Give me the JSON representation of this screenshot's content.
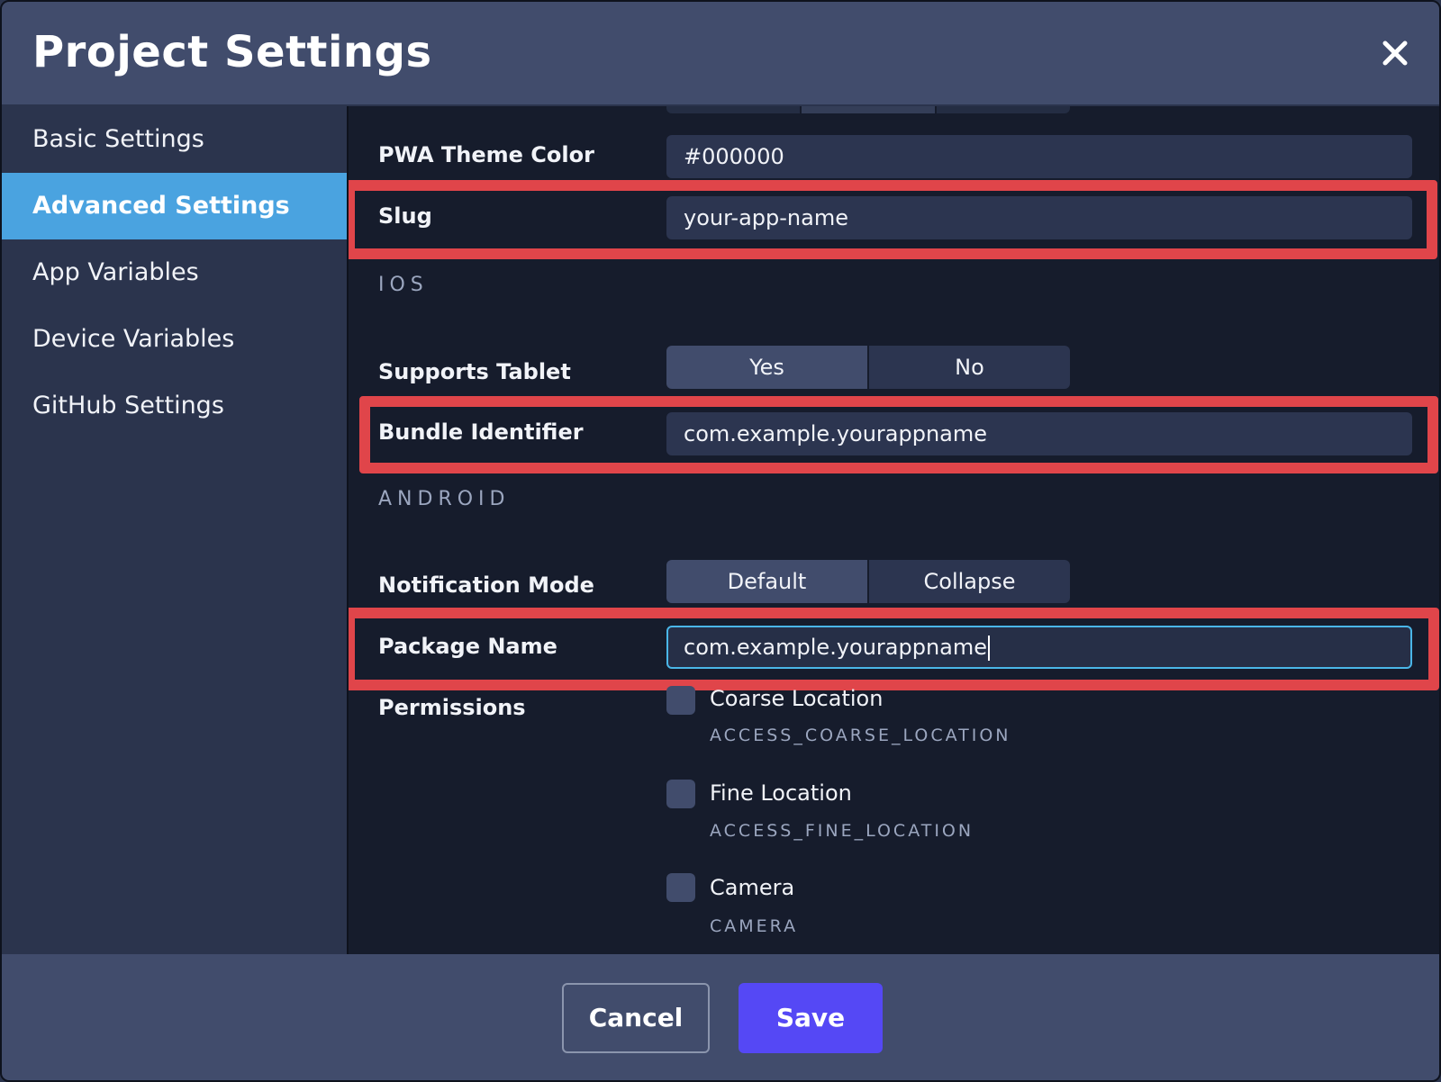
{
  "dialog": {
    "title": "Project Settings"
  },
  "sidebar": {
    "items": [
      {
        "label": "Basic Settings"
      },
      {
        "label": "Advanced Settings",
        "active": true
      },
      {
        "label": "App Variables"
      },
      {
        "label": "Device Variables"
      },
      {
        "label": "GitHub Settings"
      }
    ]
  },
  "fields": {
    "pwa_theme_color": {
      "label": "PWA Theme Color",
      "value": "#000000"
    },
    "slug": {
      "label": "Slug",
      "value": "your-app-name"
    }
  },
  "ios": {
    "section_title": "IOS",
    "supports_tablet": {
      "label": "Supports Tablet",
      "options": [
        "Yes",
        "No"
      ],
      "selected": "Yes"
    },
    "bundle_identifier": {
      "label": "Bundle Identifier",
      "value": "com.example.yourappname"
    }
  },
  "android": {
    "section_title": "ANDROID",
    "notification_mode": {
      "label": "Notification Mode",
      "options": [
        "Default",
        "Collapse"
      ],
      "selected": "Default"
    },
    "package_name": {
      "label": "Package Name",
      "value": "com.example.yourappname"
    },
    "permissions": {
      "label": "Permissions",
      "items": [
        {
          "name": "Coarse Location",
          "code": "ACCESS_COARSE_LOCATION",
          "checked": false
        },
        {
          "name": "Fine Location",
          "code": "ACCESS_FINE_LOCATION",
          "checked": false
        },
        {
          "name": "Camera",
          "code": "CAMERA",
          "checked": false
        }
      ]
    }
  },
  "footer": {
    "cancel_label": "Cancel",
    "save_label": "Save"
  },
  "colors": {
    "accent": "#4aa3e0",
    "primary_button": "#5548f5",
    "highlight": "#e0454a",
    "focus_border": "#4ab6e8"
  },
  "icons": {
    "close": "close-icon"
  }
}
